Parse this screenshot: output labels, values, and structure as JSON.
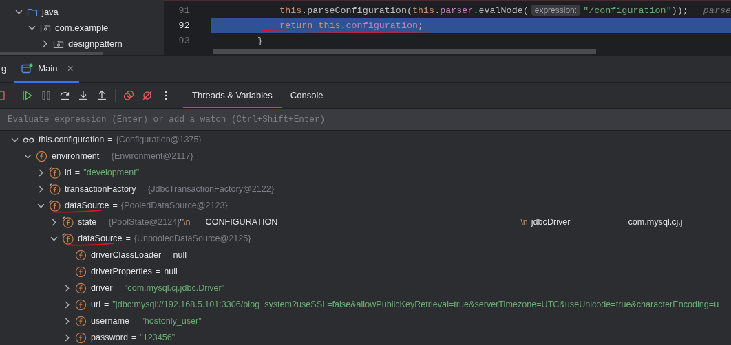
{
  "project_tree": [
    {
      "label": "java",
      "kind": "source-folder",
      "expanded": true,
      "children": [
        {
          "label": "com.example",
          "kind": "package",
          "expanded": true,
          "children": [
            {
              "label": "designpattern",
              "kind": "package",
              "expanded": false
            }
          ]
        }
      ]
    }
  ],
  "editor": {
    "lines": [
      {
        "number": "91",
        "current": false,
        "annotated": false,
        "tokens": [
          {
            "text": "            this",
            "kind": "keyword"
          },
          {
            "text": ".parseConfiguration(",
            "kind": "plain"
          },
          {
            "text": "this",
            "kind": "keyword"
          },
          {
            "text": ".",
            "kind": "plain"
          },
          {
            "text": "parser",
            "kind": "field"
          },
          {
            "text": ".evalNode(",
            "kind": "plain"
          },
          {
            "text": "expression:",
            "kind": "hint"
          },
          {
            "text": "\"/configuration\"",
            "kind": "string"
          },
          {
            "text": "));",
            "kind": "plain"
          },
          {
            "text": "parse",
            "kind": "inline-value"
          }
        ]
      },
      {
        "number": "92",
        "current": true,
        "annotated": true,
        "tokens": [
          {
            "text": "            return this",
            "kind": "keyword"
          },
          {
            "text": ".",
            "kind": "plain"
          },
          {
            "text": "configuration",
            "kind": "field"
          },
          {
            "text": ";",
            "kind": "plain"
          }
        ]
      },
      {
        "number": "93",
        "current": false,
        "annotated": false,
        "tokens": [
          {
            "text": "        }",
            "kind": "plain"
          }
        ]
      }
    ]
  },
  "session_tabs": [
    {
      "label": "g",
      "selected": false,
      "closable": false
    },
    {
      "label": "Main",
      "selected": true,
      "closable": true,
      "close": "×"
    }
  ],
  "view_tabs": [
    {
      "label": "Threads & Variables",
      "selected": true
    },
    {
      "label": "Console",
      "selected": false
    }
  ],
  "evaluate": {
    "placeholder": "Evaluate expression (Enter) or add a watch (Ctrl+Shift+Enter)"
  },
  "variables": [
    {
      "name": "this.configuration",
      "kind": "watch",
      "expandable": true,
      "expanded": true,
      "annotated": false,
      "value": [
        {
          "text": "=",
          "kind": "plain"
        },
        {
          "text": "{Configuration@1375}",
          "kind": "ref"
        }
      ],
      "children": [
        {
          "name": "environment",
          "kind": "field",
          "expandable": true,
          "expanded": true,
          "annotated": false,
          "value": [
            {
              "text": "=",
              "kind": "plain"
            },
            {
              "text": "{Environment@2117}",
              "kind": "ref"
            }
          ],
          "children": [
            {
              "name": "id",
              "kind": "final-field",
              "expandable": true,
              "expanded": false,
              "annotated": false,
              "value": [
                {
                  "text": "=",
                  "kind": "plain"
                },
                {
                  "text": "\"development\"",
                  "kind": "string"
                }
              ]
            },
            {
              "name": "transactionFactory",
              "kind": "final-field",
              "expandable": true,
              "expanded": false,
              "annotated": false,
              "value": [
                {
                  "text": "=",
                  "kind": "plain"
                },
                {
                  "text": "{JdbcTransactionFactory@2122}",
                  "kind": "ref"
                }
              ]
            },
            {
              "name": "dataSource",
              "kind": "final-field",
              "expandable": true,
              "expanded": true,
              "annotated": true,
              "value": [
                {
                  "text": "=",
                  "kind": "plain"
                },
                {
                  "text": "{PooledDataSource@2123}",
                  "kind": "ref"
                }
              ],
              "children": [
                {
                  "name": "state",
                  "kind": "final-field",
                  "expandable": true,
                  "expanded": false,
                  "annotated": false,
                  "value": [
                    {
                      "text": "=",
                      "kind": "plain"
                    },
                    {
                      "text": "{PoolState@2124}",
                      "kind": "ref"
                    },
                    {
                      "text": "\"",
                      "kind": "plain-tight"
                    },
                    {
                      "text": "\\n",
                      "kind": "escape"
                    },
                    {
                      "text": "===CONFIGURATION================================================",
                      "kind": "plain-tight"
                    },
                    {
                      "text": "\\n",
                      "kind": "escape"
                    },
                    {
                      "text": "jdbcDriver",
                      "kind": "plain"
                    },
                    {
                      "text": "com.mysql.cj.j",
                      "kind": "plain-far"
                    }
                  ]
                },
                {
                  "name": "dataSource",
                  "kind": "final-field",
                  "expandable": true,
                  "expanded": true,
                  "annotated": true,
                  "value": [
                    {
                      "text": "=",
                      "kind": "plain"
                    },
                    {
                      "text": "{UnpooledDataSource@2125}",
                      "kind": "ref"
                    }
                  ],
                  "children": [
                    {
                      "name": "driverClassLoader",
                      "kind": "field",
                      "expandable": false,
                      "expanded": false,
                      "annotated": false,
                      "value": [
                        {
                          "text": "=",
                          "kind": "plain"
                        },
                        {
                          "text": "null",
                          "kind": "plain"
                        }
                      ]
                    },
                    {
                      "name": "driverProperties",
                      "kind": "field",
                      "expandable": false,
                      "expanded": false,
                      "annotated": false,
                      "value": [
                        {
                          "text": "=",
                          "kind": "plain"
                        },
                        {
                          "text": "null",
                          "kind": "plain"
                        }
                      ]
                    },
                    {
                      "name": "driver",
                      "kind": "field",
                      "expandable": true,
                      "expanded": false,
                      "annotated": false,
                      "value": [
                        {
                          "text": "=",
                          "kind": "plain"
                        },
                        {
                          "text": "\"com.mysql.cj.jdbc.Driver\"",
                          "kind": "string"
                        }
                      ]
                    },
                    {
                      "name": "url",
                      "kind": "field",
                      "expandable": true,
                      "expanded": false,
                      "annotated": false,
                      "value": [
                        {
                          "text": "=",
                          "kind": "plain"
                        },
                        {
                          "text": "\"jdbc:mysql://192.168.5.101:3306/blog_system?useSSL=false&allowPublicKeyRetrieval=true&serverTimezone=UTC&useUnicode=true&characterEncoding=u",
                          "kind": "string"
                        }
                      ]
                    },
                    {
                      "name": "username",
                      "kind": "field",
                      "expandable": true,
                      "expanded": false,
                      "annotated": false,
                      "value": [
                        {
                          "text": "=",
                          "kind": "plain"
                        },
                        {
                          "text": "\"hostonly_user\"",
                          "kind": "string"
                        }
                      ]
                    },
                    {
                      "name": "password",
                      "kind": "field",
                      "expandable": true,
                      "expanded": false,
                      "annotated": false,
                      "value": [
                        {
                          "text": "=",
                          "kind": "plain"
                        },
                        {
                          "text": "\"123456\"",
                          "kind": "string"
                        }
                      ]
                    }
                  ]
                }
              ]
            }
          ]
        }
      ]
    }
  ]
}
